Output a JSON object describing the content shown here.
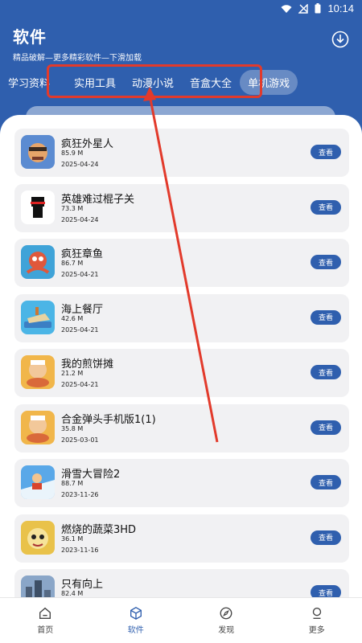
{
  "status_bar": {
    "time": "10:14",
    "icons": [
      "wifi-icon",
      "signal-icon",
      "battery-icon"
    ]
  },
  "header": {
    "title": "软件",
    "subtitle": "精品破解—更多精彩软件—下滑加载",
    "download_icon": "download-icon"
  },
  "tabs": [
    "学习资料",
    "实用工具",
    "动漫小说",
    "音盒大全",
    "单机游戏"
  ],
  "active_tab": "单机游戏",
  "apps": [
    {
      "name": "疯狂外星人",
      "size": "85.9 M",
      "date": "2025-04-24",
      "button": "查看",
      "color": "#5b8bd1"
    },
    {
      "name": "英雄难过棍子关",
      "size": "73.3 M",
      "date": "2025-04-24",
      "button": "查看",
      "color": "#ffffff"
    },
    {
      "name": "疯狂章鱼",
      "size": "86.7 M",
      "date": "2025-04-21",
      "button": "查看",
      "color": "#3fa3d8"
    },
    {
      "name": "海上餐厅",
      "size": "42.6 M",
      "date": "2025-04-21",
      "button": "查看",
      "color": "#4bb5e6"
    },
    {
      "name": "我的煎饼摊",
      "size": "21.2 M",
      "date": "2025-04-21",
      "button": "查看",
      "color": "#f1b64a"
    },
    {
      "name": "合金弹头手机版1(1)",
      "size": "35.8 M",
      "date": "2025-03-01",
      "button": "查看",
      "color": "#f1b64a"
    },
    {
      "name": "滑雪大冒险2",
      "size": "88.7 M",
      "date": "2023-11-26",
      "button": "查看",
      "color": "#5aa8e8"
    },
    {
      "name": "燃烧的蔬菜3HD",
      "size": "36.1 M",
      "date": "2023-11-16",
      "button": "查看",
      "color": "#e9c24a"
    },
    {
      "name": "只有向上",
      "size": "82.4 M",
      "date": "",
      "button": "查看",
      "color": "#8aa6c8"
    }
  ],
  "bottom_nav": [
    {
      "label": "首页",
      "icon": "home-icon"
    },
    {
      "label": "软件",
      "icon": "cube-icon"
    },
    {
      "label": "发现",
      "icon": "compass-icon"
    },
    {
      "label": "更多",
      "icon": "profile-icon"
    }
  ],
  "active_nav": "软件",
  "colors": {
    "primary": "#2f5fae",
    "annotation": "#e23a2b",
    "card_bg": "#f1f1f3"
  }
}
